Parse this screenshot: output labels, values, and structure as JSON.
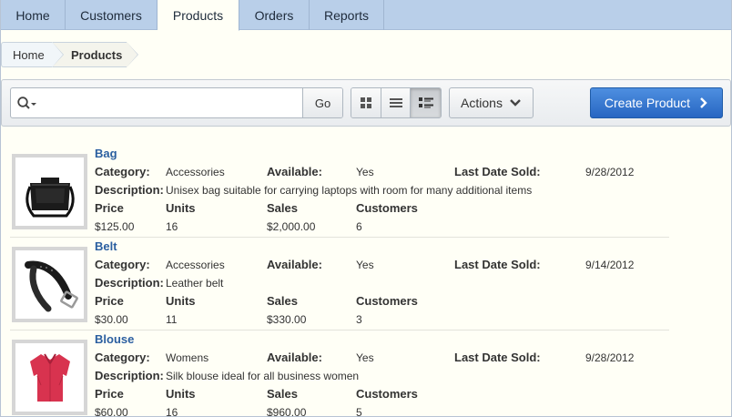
{
  "tabs": [
    {
      "label": "Home",
      "active": false
    },
    {
      "label": "Customers",
      "active": false
    },
    {
      "label": "Products",
      "active": true
    },
    {
      "label": "Orders",
      "active": false
    },
    {
      "label": "Reports",
      "active": false
    }
  ],
  "breadcrumb": {
    "home": "Home",
    "current": "Products"
  },
  "toolbar": {
    "search_value": "",
    "search_placeholder": "",
    "go_label": "Go",
    "view_modes": [
      "icons-view",
      "report-view",
      "detail-view"
    ],
    "active_view": "detail-view",
    "actions_label": "Actions",
    "create_label": "Create Product"
  },
  "field_labels": {
    "category": "Category:",
    "available": "Available:",
    "last_date_sold": "Last Date Sold:",
    "description": "Description:",
    "price": "Price",
    "units": "Units",
    "sales": "Sales",
    "customers": "Customers"
  },
  "products": [
    {
      "name": "Bag",
      "category": "Accessories",
      "available": "Yes",
      "last_date_sold": "9/28/2012",
      "description": "Unisex bag suitable for carrying laptops with room for many additional items",
      "price": "$125.00",
      "units": "16",
      "sales": "$2,000.00",
      "customers": "6",
      "image_icon": "bag-icon"
    },
    {
      "name": "Belt",
      "category": "Accessories",
      "available": "Yes",
      "last_date_sold": "9/14/2012",
      "description": "Leather belt",
      "price": "$30.00",
      "units": "11",
      "sales": "$330.00",
      "customers": "3",
      "image_icon": "belt-icon"
    },
    {
      "name": "Blouse",
      "category": "Womens",
      "available": "Yes",
      "last_date_sold": "9/28/2012",
      "description": "Silk blouse ideal for all business women",
      "price": "$60.00",
      "units": "16",
      "sales": "$960.00",
      "customers": "5",
      "image_icon": "blouse-icon"
    }
  ],
  "colors": {
    "tab_bar": "#b9cfe9",
    "background": "#fffff6",
    "link": "#2b5fa0",
    "create_button": "#2e6fcf"
  }
}
